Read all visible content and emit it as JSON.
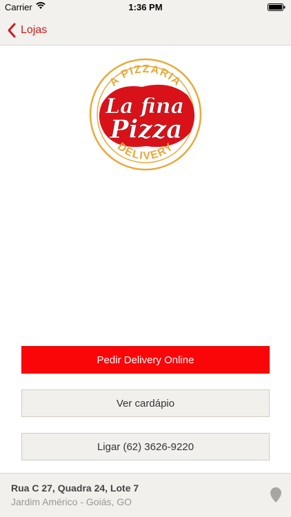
{
  "status_bar": {
    "carrier": "Carrier",
    "time": "1:36 PM"
  },
  "nav": {
    "back_label": "Lojas",
    "accent_color": "#d0181d"
  },
  "logo": {
    "top_text": "A PIZZARIA",
    "script_line1": "La fina",
    "script_line2": "Pizza",
    "bottom_text": "DELIVERY"
  },
  "actions": {
    "order_online": "Pedir Delivery Online",
    "view_menu": "Ver cardápio",
    "call": "Ligar (62) 3626-9220"
  },
  "footer": {
    "address_line1": "Rua C 27, Quadra 24, Lote 7",
    "address_line2": "Jardim Américo - Goiás, GO"
  },
  "icons": {
    "back": "chevron-left-icon",
    "wifi": "wifi-icon",
    "battery": "battery-icon",
    "location": "map-pin-icon"
  }
}
